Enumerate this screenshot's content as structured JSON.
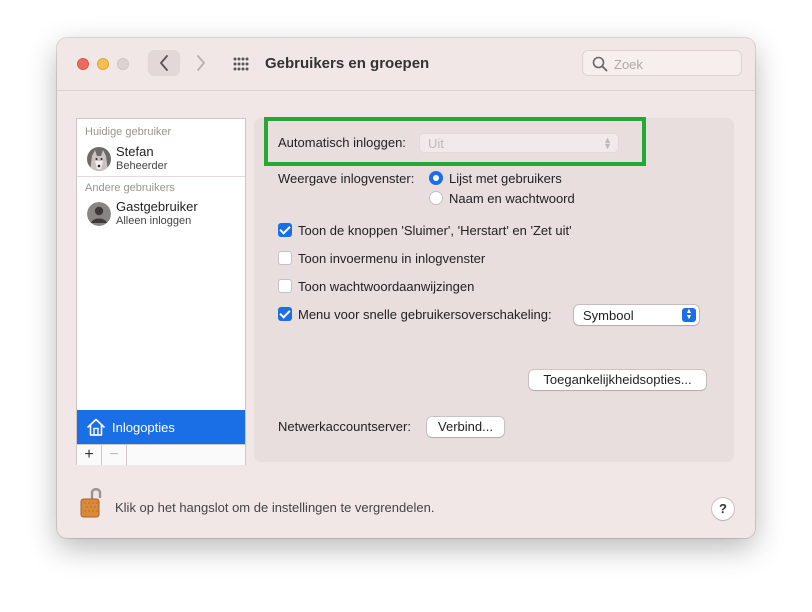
{
  "window": {
    "title": "Gebruikers en groepen",
    "search_placeholder": "Zoek"
  },
  "sidebar": {
    "current_header": "Huidige gebruiker",
    "other_header": "Andere gebruikers",
    "users": [
      {
        "name": "Stefan",
        "role": "Beheerder"
      },
      {
        "name": "Gastgebruiker",
        "role": "Alleen inloggen"
      }
    ],
    "login_options_label": "Inlogopties",
    "add_label": "+",
    "remove_label": "−"
  },
  "options": {
    "auto_login_label": "Automatisch inloggen:",
    "auto_login_value": "Uit",
    "display_label": "Weergave inlogvenster:",
    "radio_list": "Lijst met gebruikers",
    "radio_name_password": "Naam en wachtwoord",
    "chk_buttons": "Toon de knoppen 'Sluimer', 'Herstart' en 'Zet uit'",
    "chk_input_menu": "Toon invoermenu in inlogvenster",
    "chk_password_hints": "Toon wachtwoordaanwijzingen",
    "chk_fast_switch": "Menu voor snelle gebruikersoverschakeling:",
    "fast_switch_value": "Symbool",
    "accessibility_button": "Toegankelijkheidsopties...",
    "network_label": "Netwerkaccountserver:",
    "connect_button": "Verbind..."
  },
  "footer": {
    "lock_text": "Klik op het hangslot om de instellingen te vergrendelen.",
    "help_label": "?"
  },
  "colors": {
    "accent": "#1a6ee6",
    "highlight": "#27a836",
    "window_bg": "#f1e7e6"
  }
}
